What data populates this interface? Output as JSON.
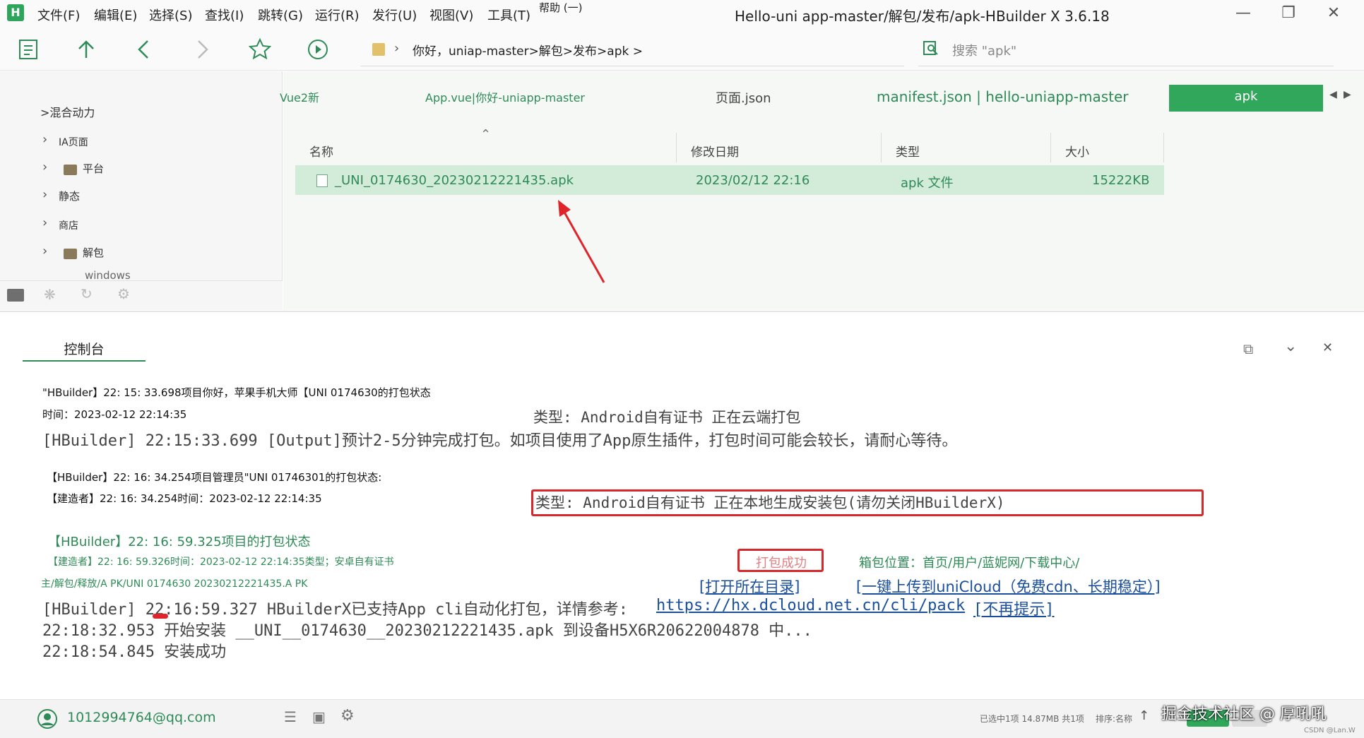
{
  "window": {
    "title": "Hello-uni app-master/解包/发布/apk-HBuilder X 3.6.18",
    "menus": [
      "文件(F)",
      "编辑(E)",
      "选择(S)",
      "查找(I)",
      "跳转(G)",
      "运行(R)",
      "发行(U)",
      "视图(V)",
      "工具(T)",
      "帮助 (一)"
    ]
  },
  "toolbar": {
    "breadcrumb": "你好，uniap-master>解包>发布>apk >",
    "search_placeholder": "搜索 \"apk\""
  },
  "sidebar": {
    "root": ">混合动力",
    "items": [
      "IA页面",
      "平台",
      "静态",
      "商店",
      "解包",
      "windows"
    ]
  },
  "tabs": [
    {
      "label": "Vue2新"
    },
    {
      "label": "App.vue|你好-uniapp-master"
    },
    {
      "label": "页面.json"
    },
    {
      "label": "manifest.json | hello-uniapp-master"
    },
    {
      "label": "apk"
    }
  ],
  "file_table": {
    "headers": [
      "名称",
      "修改日期",
      "类型",
      "大小"
    ],
    "rows": [
      {
        "name": "_UNI_0174630_20230212221435.apk",
        "date": "2023/02/12 22:16",
        "type": "apk 文件",
        "size": "15222KB"
      }
    ]
  },
  "console": {
    "tab_label": "控制台",
    "lines": {
      "l1": "\"HBuilder】22: 15: 33.698项目你好，苹果手机大师【UNI 0174630的打包状态",
      "l2": "时间：2023-02-12 22:14:35",
      "l2b": "类型: Android自有证书       正在云端打包",
      "l3": "[HBuilder] 22:15:33.699 [Output]预计2-5分钟完成打包。如项目使用了App原生插件，打包时间可能会较长，请耐心等待。",
      "l4": "【HBuilder】22: 16: 34.254项目管理员\"UNI 01746301的打包状态:",
      "l5": "【建造者】22: 16: 34.254时间：2023-02-12 22:14:35",
      "l5b": "类型: Android自有证书       正在本地生成安装包(请勿关闭HBuilderX)",
      "l6": "【HBuilder】22: 16: 59.325项目的打包状态",
      "l7": "【建造者】22: 16: 59.326时间：2023-02-12 22:14:35类型；安卓自有证书",
      "l7_success": "打包成功",
      "l7_pkg": "箱包位置：首页/用户/蓝妮网/下载中心/",
      "l8_path": "主/解包/释放/A PK/UNI 0174630 20230212221435.A PK",
      "l8_open": "[打开所在目录]",
      "l8_upload": "[一键上传到uniCloud（免费cdn、长期稳定）]",
      "l9_prefix": "[HBuilder] 22:16:59.327 HBuilderX已支持App cli自动化打包，详情参考:",
      "l9_link": "https://hx.dcloud.net.cn/cli/pack",
      "l9_dismiss": "[不再提示]",
      "l10": "22:18:32.953 开始安装 __UNI__0174630__20230212221435.apk 到设备H5X6R20622004878 中...",
      "l11": "22:18:54.845 安装成功"
    }
  },
  "status": {
    "account": "1012994764@qq.com",
    "selection": "已选中1项 14.87MB 共1项",
    "sort": "排序:名称",
    "watermark": "掘金技术社区 @ 厚吼吼",
    "watermark_small": "CSDN @Lan.W"
  },
  "colors": {
    "accent": "#30a75b",
    "highlight_row": "#d3ebd9",
    "alert_red": "#d6282b",
    "link": "#1a4f9c"
  }
}
